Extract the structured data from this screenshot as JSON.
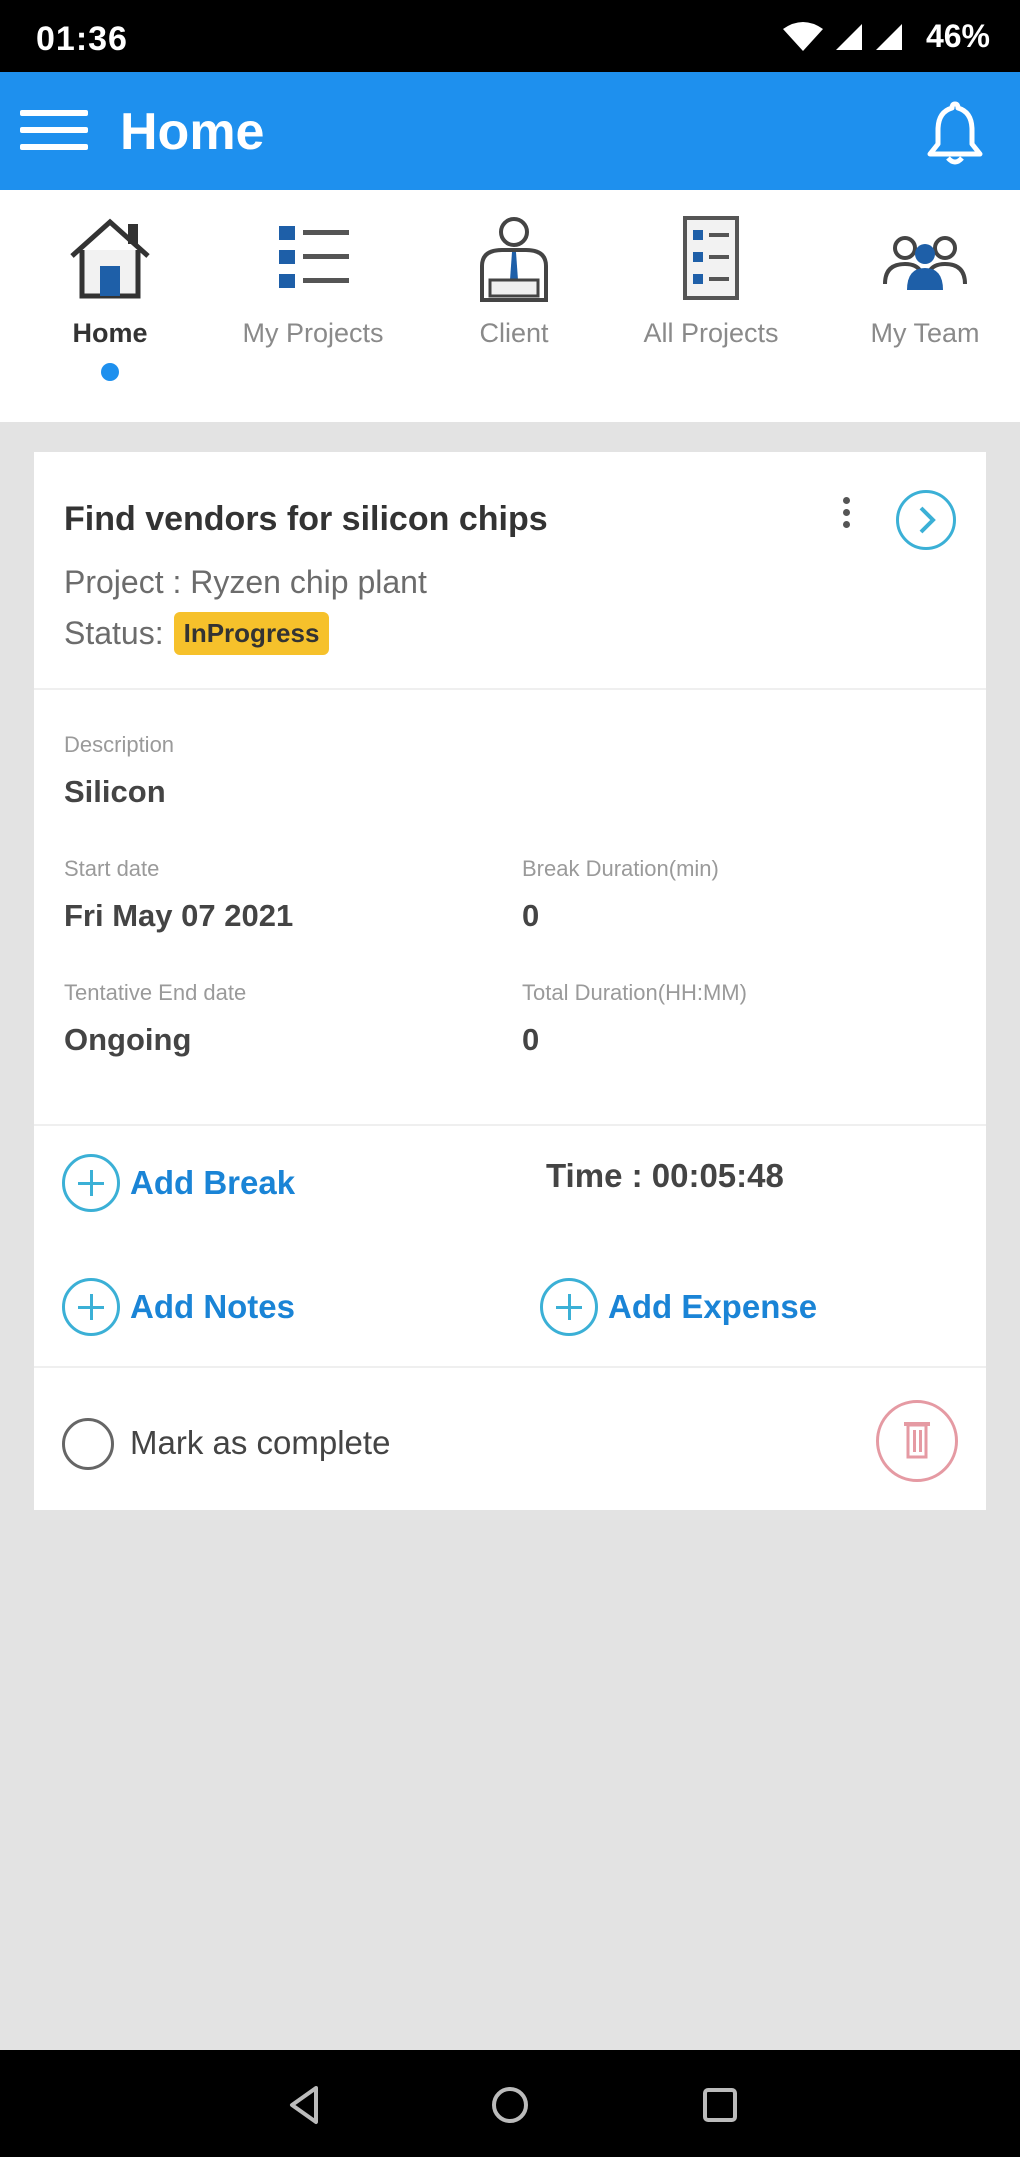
{
  "status_bar": {
    "time": "01:36",
    "battery": "46%"
  },
  "app_bar": {
    "title": "Home"
  },
  "tabs": [
    {
      "label": "Home",
      "icon": "home-icon"
    },
    {
      "label": "My Projects",
      "icon": "list-icon"
    },
    {
      "label": "Client",
      "icon": "client-icon"
    },
    {
      "label": "All Projects",
      "icon": "checklist-icon"
    },
    {
      "label": "My Team",
      "icon": "team-icon"
    }
  ],
  "task": {
    "title": "Find vendors for silicon chips",
    "project": "Project : Ryzen chip plant",
    "status_prefix": "Status:",
    "status": "InProgress",
    "description_label": "Description",
    "description": "Silicon",
    "start_date_label": "Start date",
    "start_date": "Fri May 07 2021",
    "break_duration_label": "Break Duration(min)",
    "break_duration": "0",
    "end_date_label": "Tentative End date",
    "end_date": "Ongoing",
    "total_duration_label": "Total Duration(HH:MM)",
    "total_duration": "0",
    "add_break": "Add Break",
    "time": "Time : 00:05:48",
    "add_notes": "Add Notes",
    "add_expense": "Add Expense",
    "mark_complete": "Mark as complete"
  },
  "colors": {
    "primary": "#1e90ee",
    "accent": "#3bb0d6",
    "badge": "#f6c12b",
    "delete": "#e59aa3",
    "background": "#e3e3e3"
  }
}
